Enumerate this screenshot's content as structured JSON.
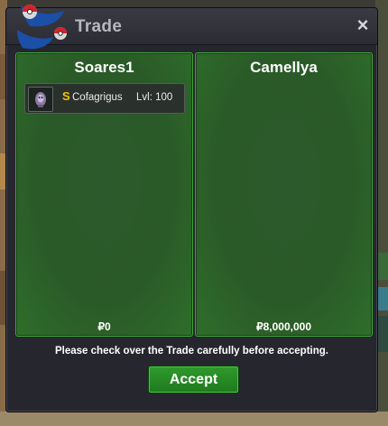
{
  "window": {
    "title": "Trade",
    "close_label": "×"
  },
  "trade": {
    "left": {
      "name": "Soares1",
      "money": "₽0",
      "items": [
        {
          "coin_symbol": "S",
          "name": "Cofagrigus",
          "level": "Lvl: 100",
          "icon": "cofagrigus-sprite-icon"
        }
      ]
    },
    "right": {
      "name": "Camellya",
      "money": "₽8,000,000",
      "items": []
    }
  },
  "notice": "Please check over the Trade carefully before accepting.",
  "accept_label": "Accept",
  "colors": {
    "panel_green": "#2a5a27",
    "panel_border": "#3fa63a",
    "accept_green": "#2f9a2c",
    "window_bg": "#26262e",
    "coin_gold": "#f0c40b"
  }
}
